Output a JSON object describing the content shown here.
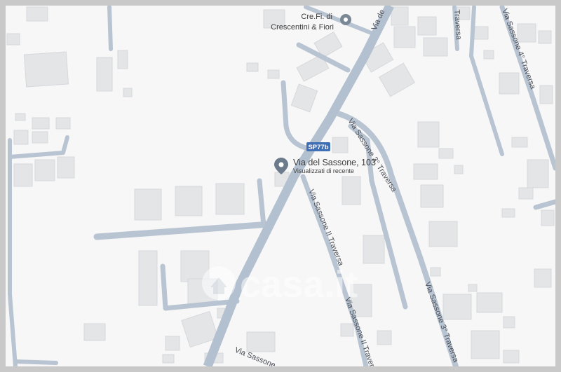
{
  "map": {
    "background_color": "#f7f7f7",
    "frame_color": "#c9c9c9",
    "road_color": "#b8c4d2",
    "building_color": "#e4e5e7",
    "pin_color": "#6b7b8c"
  },
  "places": {
    "crefi_line1": "Cre.Fi. di",
    "crefi_line2": "Crescentini & Fiori",
    "selected_address": "Via del Sassone, 103",
    "selected_subtitle": "Visualizzati di recente"
  },
  "roads": {
    "via_del_top": "Via de",
    "sassone_4": "Via Sassone 4° Traversa",
    "sassone_3_upper": "Via Sassone 3° Traversa",
    "sassone_2": "Via Sassone II Traversa",
    "sassone_2_lower": "Via Sassone II Traversa",
    "sassone_3_lower": "Via Sassone 3° Traversa",
    "via_sassone_bottom": "Via Sassone",
    "top_right_traversa": "Traversa"
  },
  "shield": {
    "label": "SP77b",
    "color": "#3f6fb5"
  },
  "watermark": {
    "text": "casa.it"
  }
}
